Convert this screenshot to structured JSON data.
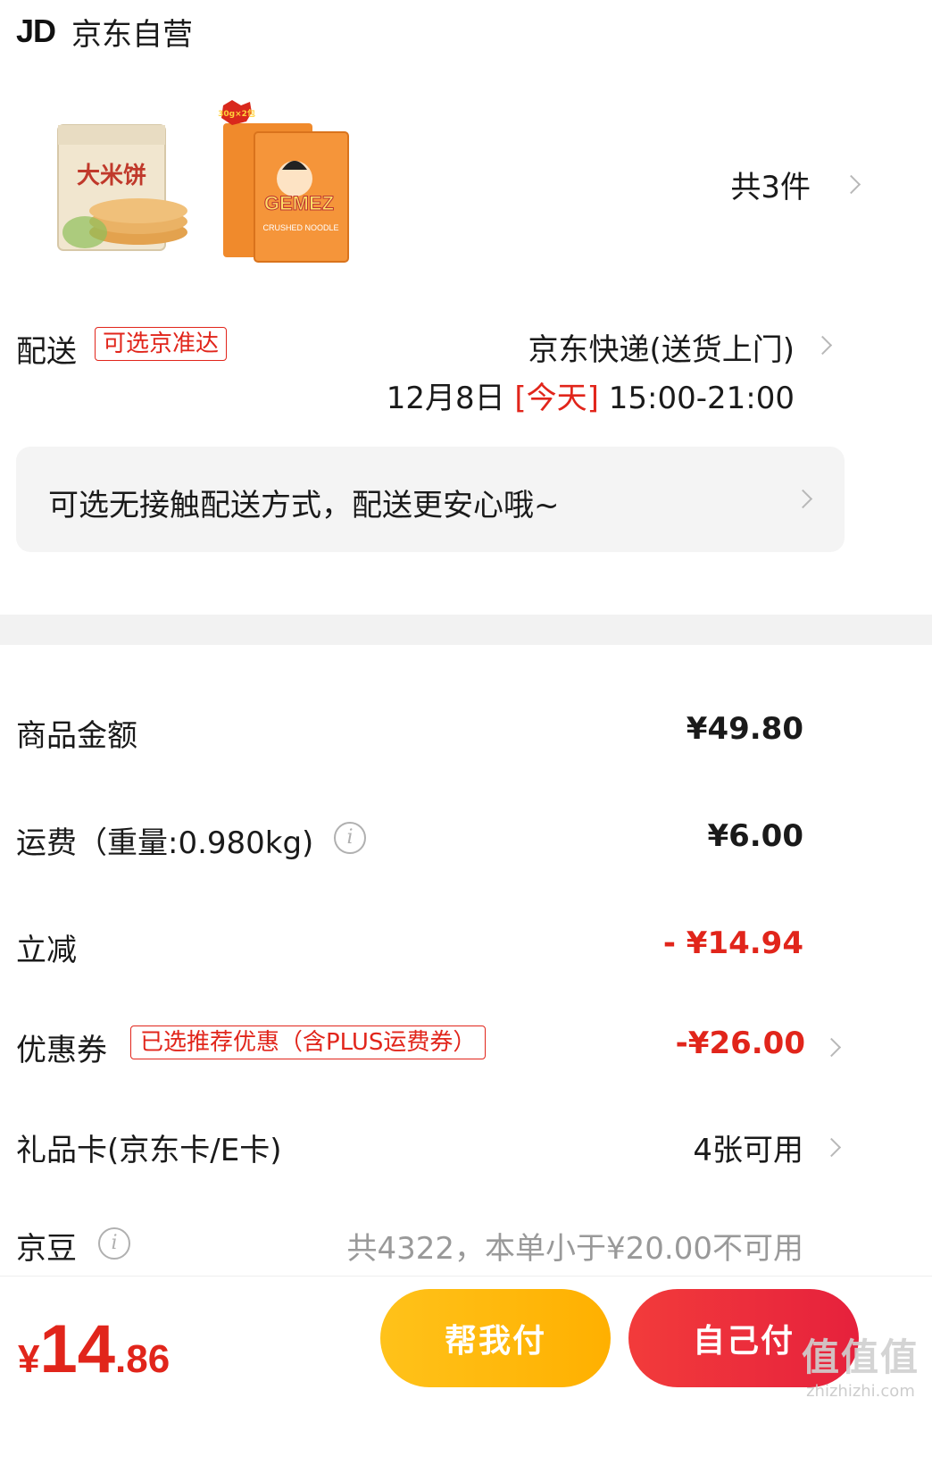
{
  "shop": {
    "logo": "JD",
    "name": "京东自营"
  },
  "products": {
    "count_text": "共3件",
    "thumb1_badge": "大米饼",
    "thumb2_brand": "GEMEZ",
    "thumb2_sub": "CRUSHED NOODLE",
    "thumb2_badge": "30g×2包"
  },
  "delivery": {
    "label": "配送",
    "tag": "可选京准达",
    "method": "京东快递(送货上门)",
    "date": "12月8日",
    "today": "[今天]",
    "time": "15:00-21:00"
  },
  "notice": {
    "text": "可选无接触配送方式，配送更安心哦~"
  },
  "summary": {
    "goods": {
      "label": "商品金额",
      "value": "¥49.80"
    },
    "shipping": {
      "label": "运费（重量:0.980kg)",
      "value": "¥6.00"
    },
    "discount": {
      "label": "立减",
      "value": "- ¥14.94"
    },
    "coupon": {
      "label": "优惠券",
      "tag": "已选推荐优惠（含PLUS运费券）",
      "value": "-¥26.00"
    },
    "giftcard": {
      "label": "礼品卡(京东卡/E卡)",
      "value": "4张可用"
    },
    "beans": {
      "label": "京豆",
      "value": "共4322，本单小于¥20.00不可用"
    }
  },
  "bottom": {
    "currency": "¥",
    "total_int": "14",
    "total_dec": ".86",
    "help_pay": "帮我付",
    "self_pay": "自己付"
  },
  "watermark": {
    "main": "值值值",
    "sub": "zhizhizhi.com"
  },
  "colors": {
    "accent_red": "#e1251b",
    "button_yellow": "#ffb000",
    "button_red": "#e6213c",
    "panel_grey": "#f4f4f4"
  }
}
